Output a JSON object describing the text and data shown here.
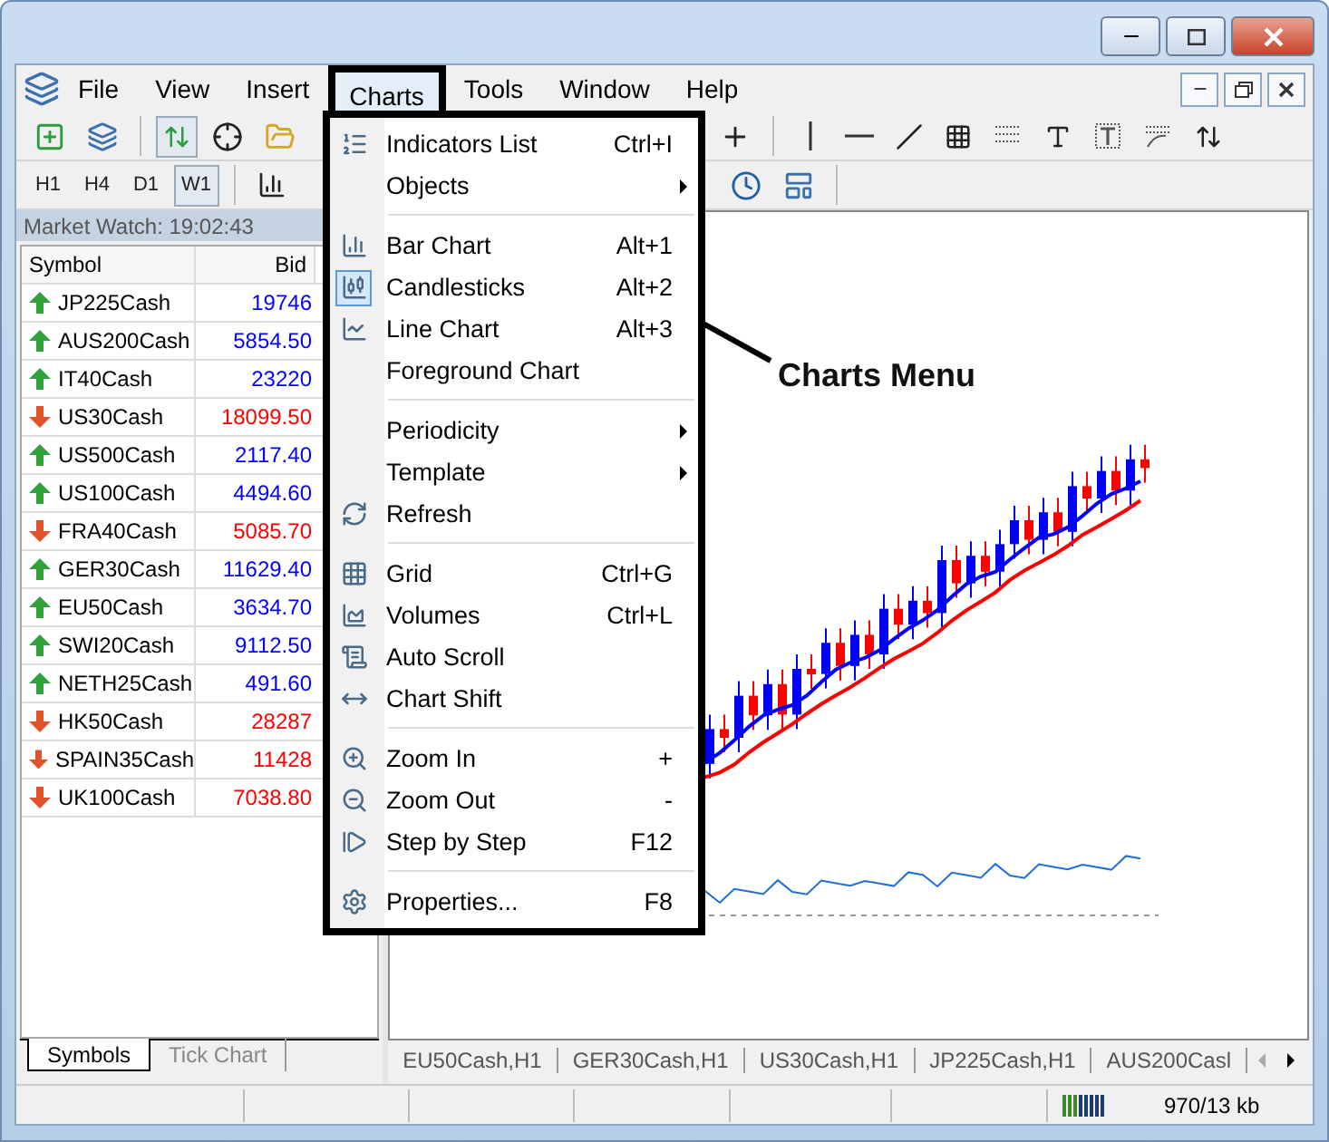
{
  "menu_bar": {
    "items": [
      {
        "label": "File",
        "selected": false
      },
      {
        "label": "View",
        "selected": false
      },
      {
        "label": "Insert",
        "selected": false
      },
      {
        "label": "Charts",
        "selected": true
      },
      {
        "label": "Tools",
        "selected": false
      },
      {
        "label": "Window",
        "selected": false
      },
      {
        "label": "Help",
        "selected": false
      }
    ]
  },
  "period_buttons": [
    {
      "label": "H1",
      "selected": false
    },
    {
      "label": "H4",
      "selected": false
    },
    {
      "label": "D1",
      "selected": false
    },
    {
      "label": "W1",
      "selected": true
    }
  ],
  "market_watch": {
    "title": "Market Watch: 19:02:43",
    "columns": [
      "Symbol",
      "Bid"
    ],
    "rows": [
      {
        "symbol": "JP225Cash",
        "bid": "19746",
        "rising": true
      },
      {
        "symbol": "AUS200Cash",
        "bid": "5854.50",
        "rising": true
      },
      {
        "symbol": "IT40Cash",
        "bid": "23220",
        "rising": true
      },
      {
        "symbol": "US30Cash",
        "bid": "18099.50",
        "rising": false
      },
      {
        "symbol": "US500Cash",
        "bid": "2117.40",
        "rising": true
      },
      {
        "symbol": "US100Cash",
        "bid": "4494.60",
        "rising": true
      },
      {
        "symbol": "FRA40Cash",
        "bid": "5085.70",
        "rising": false
      },
      {
        "symbol": "GER30Cash",
        "bid": "11629.40",
        "rising": true
      },
      {
        "symbol": "EU50Cash",
        "bid": "3634.70",
        "rising": true
      },
      {
        "symbol": "SWI20Cash",
        "bid": "9112.50",
        "rising": true
      },
      {
        "symbol": "NETH25Cash",
        "bid": "491.60",
        "rising": true
      },
      {
        "symbol": "HK50Cash",
        "bid": "28287",
        "rising": false
      },
      {
        "symbol": "SPAIN35Cash",
        "bid": "11428",
        "rising": false
      },
      {
        "symbol": "UK100Cash",
        "bid": "7038.80",
        "rising": false
      }
    ],
    "tabs": [
      {
        "label": "Symbols",
        "selected": true
      },
      {
        "label": "Tick Chart",
        "selected": false
      }
    ]
  },
  "chart_tabs": [
    {
      "label": "EU50Cash,H1"
    },
    {
      "label": "GER30Cash,H1"
    },
    {
      "label": "US30Cash,H1"
    },
    {
      "label": "JP225Cash,H1"
    },
    {
      "label": "AUS200Casl"
    }
  ],
  "status_bar": {
    "traffic": "970/13 kb"
  },
  "charts_menu": {
    "items": [
      {
        "kind": "item",
        "label": "Indicators List",
        "shortcut": "Ctrl+I",
        "checked": false,
        "submenu": false
      },
      {
        "kind": "item",
        "label": "Objects",
        "checked": false,
        "submenu": true
      },
      {
        "kind": "separator"
      },
      {
        "kind": "item",
        "label": "Bar Chart",
        "shortcut": "Alt+1",
        "checked": false,
        "submenu": false
      },
      {
        "kind": "item",
        "label": "Candlesticks",
        "shortcut": "Alt+2",
        "checked": true,
        "submenu": false
      },
      {
        "kind": "item",
        "label": "Line Chart",
        "shortcut": "Alt+3",
        "checked": false,
        "submenu": false
      },
      {
        "kind": "item",
        "label": "Foreground Chart",
        "checked": false,
        "submenu": false
      },
      {
        "kind": "separator"
      },
      {
        "kind": "item",
        "label": "Periodicity",
        "checked": false,
        "submenu": true
      },
      {
        "kind": "item",
        "label": "Template",
        "checked": false,
        "submenu": true
      },
      {
        "kind": "item",
        "label": "Refresh",
        "checked": false,
        "submenu": false
      },
      {
        "kind": "separator"
      },
      {
        "kind": "item",
        "label": "Grid",
        "shortcut": "Ctrl+G",
        "checked": false,
        "submenu": false
      },
      {
        "kind": "item",
        "label": "Volumes",
        "shortcut": "Ctrl+L",
        "checked": false,
        "submenu": false
      },
      {
        "kind": "item",
        "label": "Auto Scroll",
        "checked": false,
        "submenu": false
      },
      {
        "kind": "item",
        "label": "Chart Shift",
        "checked": false,
        "submenu": false
      },
      {
        "kind": "separator"
      },
      {
        "kind": "item",
        "label": "Zoom In",
        "shortcut": "+",
        "checked": false,
        "submenu": false
      },
      {
        "kind": "item",
        "label": "Zoom Out",
        "shortcut": "-",
        "checked": false,
        "submenu": false
      },
      {
        "kind": "item",
        "label": "Step by Step",
        "shortcut": "F12",
        "checked": false,
        "submenu": false
      },
      {
        "kind": "separator"
      },
      {
        "kind": "item",
        "label": "Properties...",
        "shortcut": "F8",
        "checked": false,
        "submenu": false
      }
    ]
  },
  "annotation": {
    "text": "Charts Menu"
  }
}
